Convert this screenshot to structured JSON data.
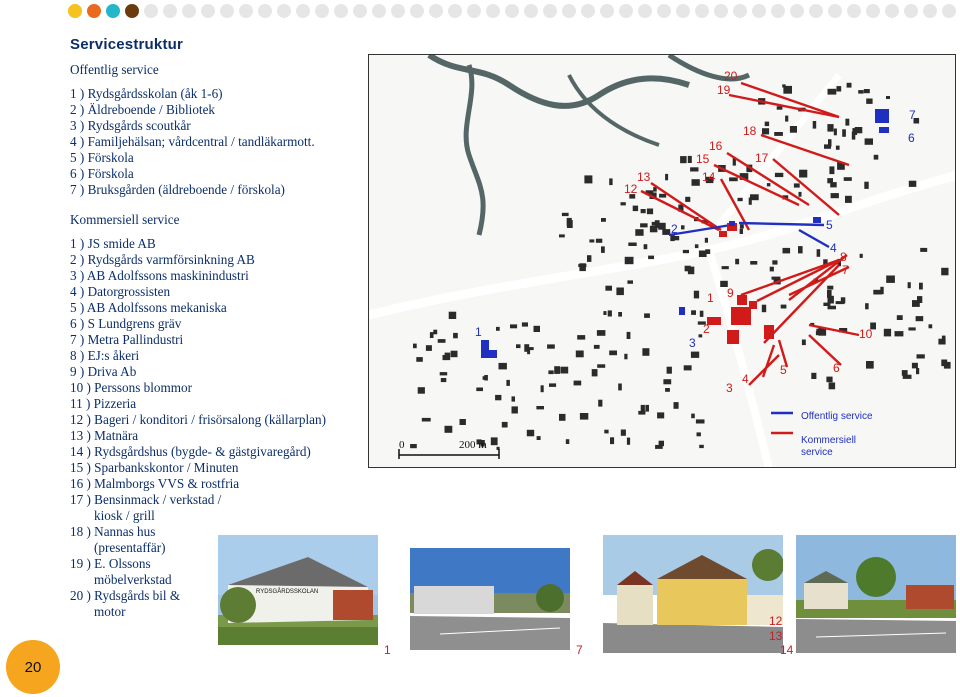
{
  "page_number": "20",
  "title": "Servicestruktur",
  "public_service": {
    "heading": "Offentlig service",
    "items": [
      "1 ) Rydsgårdsskolan (åk 1-6)",
      "2 ) Äldreboende / Bibliotek",
      "3 ) Rydsgårds scoutkår",
      "4 ) Familjehälsan; vårdcentral / tandläkarmott.",
      "5 ) Förskola",
      "6 ) Förskola",
      "7 ) Bruksgården (äldreboende / förskola)"
    ]
  },
  "commercial_service": {
    "heading": "Kommersiell service",
    "items": [
      "1 ) JS smide AB",
      "2 ) Rydsgårds varmförsinkning AB",
      "3 ) AB Adolfssons maskinindustri",
      "4 ) Datorgrossisten",
      "5 ) AB Adolfssons mekaniska",
      "6 ) S Lundgrens gräv",
      "7 ) Metra Pallindustri",
      "8 ) EJ:s åkeri",
      "9 ) Driva Ab",
      "10 ) Perssons blommor",
      "11 ) Pizzeria",
      "12 ) Bageri / konditori / frisörsalong (källarplan)",
      "13 ) Matnära",
      "14 ) Rydsgårdshus (bygde- & gästgivaregård)",
      "15 ) Sparbankskontor / Minuten",
      "16 ) Malmborgs VVS & rostfria",
      "17 ) Bensinmack / verkstad /",
      "kiosk / grill",
      "18 ) Nannas hus",
      "(presentaffär)",
      "19 ) E. Olssons",
      "möbelverkstad",
      "20 ) Rydsgårds bil &",
      "motor"
    ]
  },
  "map": {
    "scale_start": "0",
    "scale_end": "200 m",
    "legend_public": "Offentlig service",
    "legend_commercial_line1": "Kommersiell",
    "legend_commercial_line2": "service",
    "public_color": "#1f2fbf",
    "commercial_color": "#d11a1a",
    "labels_red": [
      "20",
      "19",
      "18",
      "17",
      "16",
      "15",
      "14",
      "13",
      "12",
      "1",
      "2",
      "3",
      "4",
      "5",
      "6",
      "7",
      "8",
      "9",
      "10"
    ],
    "labels_blue": [
      "7",
      "6",
      "5",
      "4",
      "2",
      "1",
      "3"
    ]
  },
  "photos": {
    "school_sign": "RYDSGÅRDSSKOLAN",
    "caption_1": "1",
    "caption_7": "7",
    "caption_12": "12",
    "caption_13": "13",
    "caption_14": "14"
  }
}
